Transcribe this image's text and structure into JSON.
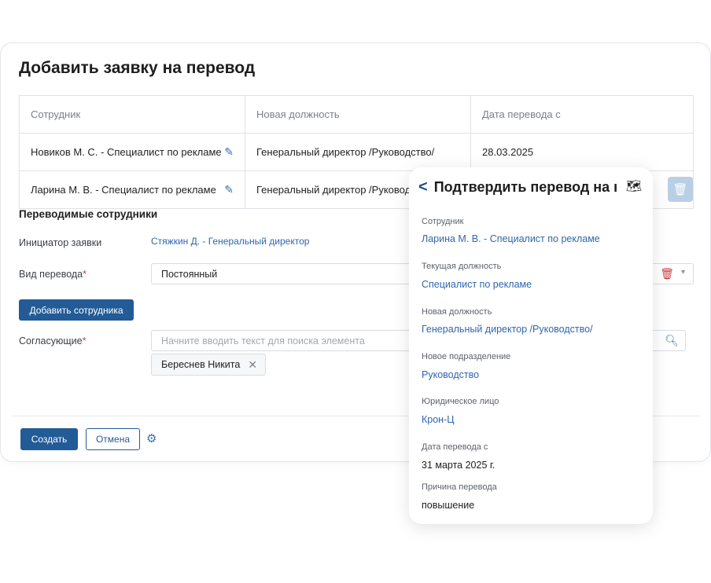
{
  "form": {
    "title": "Добавить заявку на перевод",
    "table": {
      "headers": [
        "Сотрудник",
        "Новая должность",
        "Дата перевода с"
      ],
      "rows": [
        {
          "employee": "Новиков М. С. - Специалист по рекламе",
          "position": "Генеральный директор /Руководство/",
          "date": "28.03.2025"
        },
        {
          "employee": "Ларина М. В. - Специалист по рекламе",
          "position": "Генеральный директор /Руководство/",
          "date": ""
        }
      ]
    },
    "section_title": "Переводимые сотрудники",
    "initiator_label": "Инициатор заявки",
    "initiator_value": "Стяжкин Д. - Генеральный директор",
    "transfer_type_label": "Вид перевода",
    "transfer_type_value": "Постоянный",
    "add_employee_button": "Добавить сотрудника",
    "approvers_label": "Согласующие",
    "approvers_placeholder": "Начните вводить текст для поиска элемента",
    "approvers_chip": "Береснев Никита",
    "create_button": "Создать",
    "cancel_button": "Отмена",
    "required_mark": "*"
  },
  "panel": {
    "title": "Подтвердить перевод на н",
    "fields": [
      {
        "label": "Сотрудник",
        "value": "Ларина М. В. - Специалист по рекламе"
      },
      {
        "label": "Текущая должность",
        "value": "Специалист по рекламе"
      },
      {
        "label": "Новая должность",
        "value": "Генеральный директор /Руководство/"
      },
      {
        "label": "Новое подразделение",
        "value": "Руководство"
      },
      {
        "label": "Юридическое лицо",
        "value": "Крон-Ц"
      },
      {
        "label": "Дата перевода с",
        "value": "31 марта 2025 г."
      },
      {
        "label": "Причина перевода",
        "value": "повышение"
      }
    ]
  },
  "icons": {
    "edit": "pencil-icon",
    "delete": "trash-icon",
    "dropdown": "chevron-down-icon",
    "search": "search-icon",
    "remove": "close-icon",
    "settings": "gear-icon",
    "back": "chevron-left-icon",
    "map": "map-icon"
  },
  "colors": {
    "primary": "#235b96",
    "link": "#2f66ad",
    "required": "#d23a3a"
  }
}
